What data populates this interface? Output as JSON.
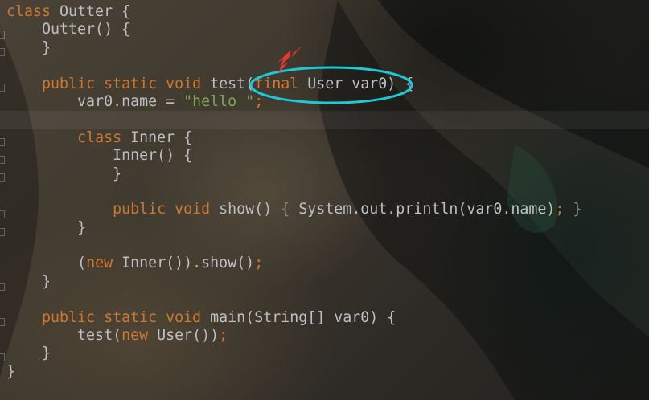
{
  "editor": {
    "lines": [
      [
        {
          "t": "class",
          "k": "kw"
        },
        {
          "t": " Outter {"
        }
      ],
      [
        {
          "t": "    Outter() {"
        }
      ],
      [
        {
          "t": "    }"
        }
      ],
      [
        {
          "t": ""
        }
      ],
      [
        {
          "t": "    "
        },
        {
          "t": "public static void",
          "k": "kw"
        },
        {
          "t": " test("
        },
        {
          "t": "final",
          "k": "kw"
        },
        {
          "t": " User var0) {"
        }
      ],
      [
        {
          "t": "        var0.name = "
        },
        {
          "t": "\"hello \"",
          "k": "str"
        },
        {
          "t": ";",
          "k": "kw"
        }
      ],
      [
        {
          "t": ""
        }
      ],
      [
        {
          "t": "        "
        },
        {
          "t": "class",
          "k": "kw"
        },
        {
          "t": " Inner {"
        }
      ],
      [
        {
          "t": "            Inner() {"
        }
      ],
      [
        {
          "t": "            }"
        }
      ],
      [
        {
          "t": ""
        }
      ],
      [
        {
          "t": "            "
        },
        {
          "t": "public void",
          "k": "kw"
        },
        {
          "t": " show() "
        },
        {
          "t": "{",
          "k": "dim"
        },
        {
          "t": " System.out.println(var0.name)"
        },
        {
          "t": ";",
          "k": "kw"
        },
        {
          "t": " }",
          "k": "dim"
        }
      ],
      [
        {
          "t": "        }"
        }
      ],
      [
        {
          "t": ""
        }
      ],
      [
        {
          "t": "        ("
        },
        {
          "t": "new",
          "k": "kw"
        },
        {
          "t": " Inner()).show()"
        },
        {
          "t": ";",
          "k": "kw"
        }
      ],
      [
        {
          "t": "    }"
        }
      ],
      [
        {
          "t": ""
        }
      ],
      [
        {
          "t": "    "
        },
        {
          "t": "public static void",
          "k": "kw"
        },
        {
          "t": " main(String[] var0) {"
        }
      ],
      [
        {
          "t": "        test("
        },
        {
          "t": "new",
          "k": "kw"
        },
        {
          "t": " User())"
        },
        {
          "t": ";",
          "k": "kw"
        }
      ],
      [
        {
          "t": "    }"
        }
      ],
      [
        {
          "t": "}"
        }
      ]
    ],
    "highlighted_line": 6
  },
  "annotation": {
    "color": "#1ec8d4",
    "arrow_color": "#e03a2f"
  }
}
